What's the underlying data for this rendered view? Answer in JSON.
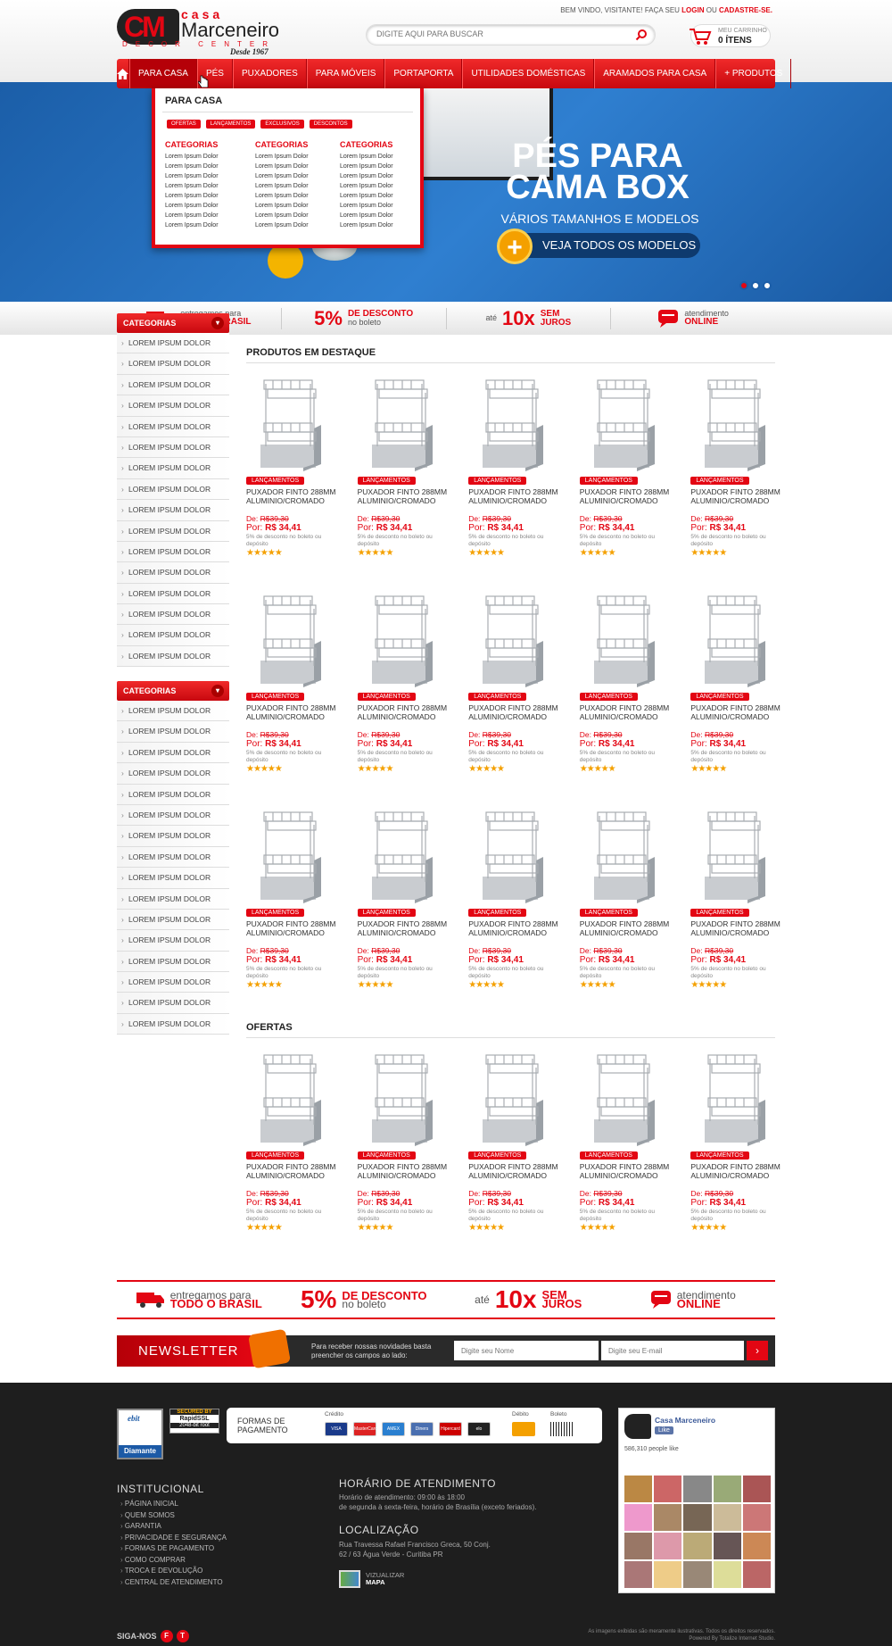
{
  "header": {
    "logo": {
      "casa": "casa",
      "name": "Marceneiro",
      "decor": "DECOR CENTER",
      "desde": "Desde 1967"
    },
    "welcome_prefix": "BEM VINDO, VISITANTE! FAÇA SEU",
    "login": "LOGIN",
    "or": "OU",
    "register": "CADASTRE-SE.",
    "search_placeholder": "DIGITE AQUI PARA BUSCAR",
    "cart_label": "MEU CARRINHO",
    "cart_count": "0 ÍTENS"
  },
  "nav": {
    "items": [
      "PARA CASA",
      "PÉS",
      "PUXADORES",
      "PARA MÓVEIS",
      "PORTAPORTA",
      "UTILIDADES DOMÉSTICAS",
      "ARAMADOS PARA CASA",
      "+ PRODUTOS"
    ]
  },
  "dropdown": {
    "title": "PARA CASA",
    "tags": [
      "OFERTAS",
      "LANÇAMENTOS",
      "EXCLUSIVOS",
      "DESCONTOS"
    ],
    "col_title": "CATEGORIAS",
    "item": "Lorem Ipsum Dolor"
  },
  "banner": {
    "line1": "PÉS PARA",
    "line2": "CAMA BOX",
    "sub": "VÁRIOS TAMANHOS E MODELOS",
    "cta": "VEJA TODOS OS MODELOS"
  },
  "benefits": {
    "ship_small": "entregamos para",
    "ship_big": "TODO O BRASIL",
    "disc_pct": "5%",
    "disc_big": "DE DESCONTO",
    "disc_small": "no boleto",
    "inst_pre": "até",
    "inst_num": "10x",
    "inst_big1": "SEM",
    "inst_big2": "JUROS",
    "att_small": "atendimento",
    "att_big": "ONLINE"
  },
  "sidebar": {
    "title": "CATEGORIAS",
    "item": "LOREM IPSUM DOLOR"
  },
  "featured_title": "PRODUTOS EM DESTAQUE",
  "offers_title": "OFERTAS",
  "product": {
    "tag": "LANÇAMENTOS",
    "name": "PUXADOR FINTO 288MM ALUMINIO/CROMADO",
    "de_label": "De:",
    "old_price": "R$39,30",
    "por_label": "Por:",
    "price": "R$ 34,41",
    "note": "5% de desconto no boleto ou depósito",
    "rating": 5
  },
  "newsletter": {
    "title": "NEWSLETTER",
    "text": "Para receber nossas novidades basta preencher os campos ao lado:",
    "name_placeholder": "Digite seu Nome",
    "email_placeholder": "Digite seu E-mail",
    "button": "›"
  },
  "footer": {
    "ebit": "ebit",
    "ebit_level": "Diamante",
    "ssl1": "SECURED BY",
    "ssl2": "RapidSSL",
    "ssl3": "2048-bit root",
    "pay_title1": "FORMAS DE",
    "pay_title2": "PAGAMENTO",
    "credit": "Crédito",
    "debit": "Débito",
    "boleto": "Boleto",
    "cards": [
      "VISA",
      "MasterCard",
      "AMEX",
      "Diners Club",
      "Hipercard",
      "elo"
    ],
    "card_colors": [
      "#1a3a8a",
      "#d22",
      "#2a7fd0",
      "#4a6fb0",
      "#c00",
      "#222"
    ],
    "institutional_title": "INSTITUCIONAL",
    "institutional": [
      "PÁGINA INICIAL",
      "QUEM SOMOS",
      "GARANTIA",
      "PRIVACIDADE E SEGURANÇA",
      "FORMAS DE PAGAMENTO",
      "COMO COMPRAR",
      "TROCA E DEVOLUÇÃO",
      "CENTRAL DE ATENDIMENTO"
    ],
    "hours_title": "HORÁRIO DE ATENDIMENTO",
    "hours1": "Horário de atendimento: 09:00 às 18:00",
    "hours2": "de segunda à sexta-feira, horário de Brasília (exceto feriados).",
    "loc_title": "LOCALIZAÇÃO",
    "loc1": "Rua Travessa Rafael Francisco Greca, 50 Conj.",
    "loc2": "62 / 63 Água Verde - Curitiba PR",
    "map1": "VIZUALIZAR",
    "map2": "MAPA",
    "fb_name": "Casa Marceneiro",
    "fb_like": "Like",
    "fb_people": "586,310 people like",
    "follow": "SIGA-NOS",
    "copy1": "As imagens exibidas são meramente ilustrativas. Todos os direitos reservados.",
    "copy2": "Powered By Totalize Internet Studio."
  },
  "colors": {
    "brand": "#e30613",
    "dark": "#1e1e1e",
    "banner": "#2f7fd0"
  }
}
